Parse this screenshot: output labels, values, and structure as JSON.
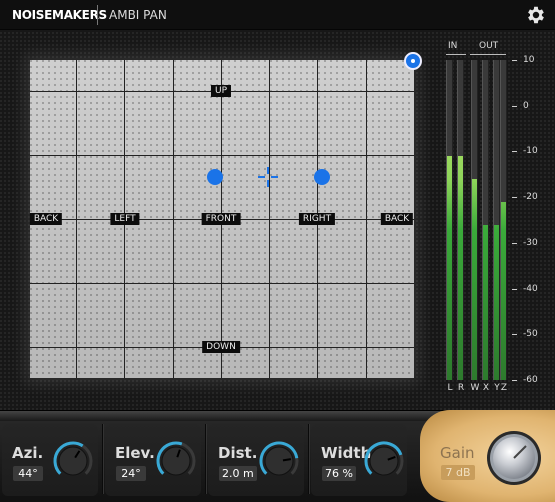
{
  "header": {
    "brand": "NOISEMAKERS",
    "plugin_name": "AMBI PAN",
    "settings_icon": "gear-icon"
  },
  "pan": {
    "labels": {
      "up": "UP",
      "down": "DOWN",
      "back_left": "BACK",
      "left": "LEFT",
      "front": "FRONT",
      "right": "RIGHT",
      "back_right": "BACK"
    },
    "accent_color": "#1a73e8",
    "corner_toggle_icon": "target-dot-icon",
    "crosshair_icon": "crosshair-icon"
  },
  "meters": {
    "in_label": "IN",
    "out_label": "OUT",
    "channels": [
      {
        "name": "L",
        "level_db": -11
      },
      {
        "name": "R",
        "level_db": -11
      },
      {
        "name": "W",
        "level_db": -16
      },
      {
        "name": "X",
        "level_db": -26
      },
      {
        "name": "Y",
        "level_db": -26
      },
      {
        "name": "Z",
        "level_db": -21
      }
    ],
    "scale": [
      "10",
      "0",
      "-10",
      "-20",
      "-30",
      "-40",
      "-50",
      "-60"
    ]
  },
  "params": [
    {
      "title": "Azi.",
      "value": "44°",
      "knob_fraction": 0.62
    },
    {
      "title": "Elev.",
      "value": "24°",
      "knob_fraction": 0.57
    },
    {
      "title": "Dist.",
      "value": "2.0 m",
      "knob_fraction": 0.8
    },
    {
      "title": "Width",
      "value": "76 %",
      "knob_fraction": 0.76
    }
  ],
  "gain": {
    "title": "Gain",
    "value": "7 dB"
  }
}
